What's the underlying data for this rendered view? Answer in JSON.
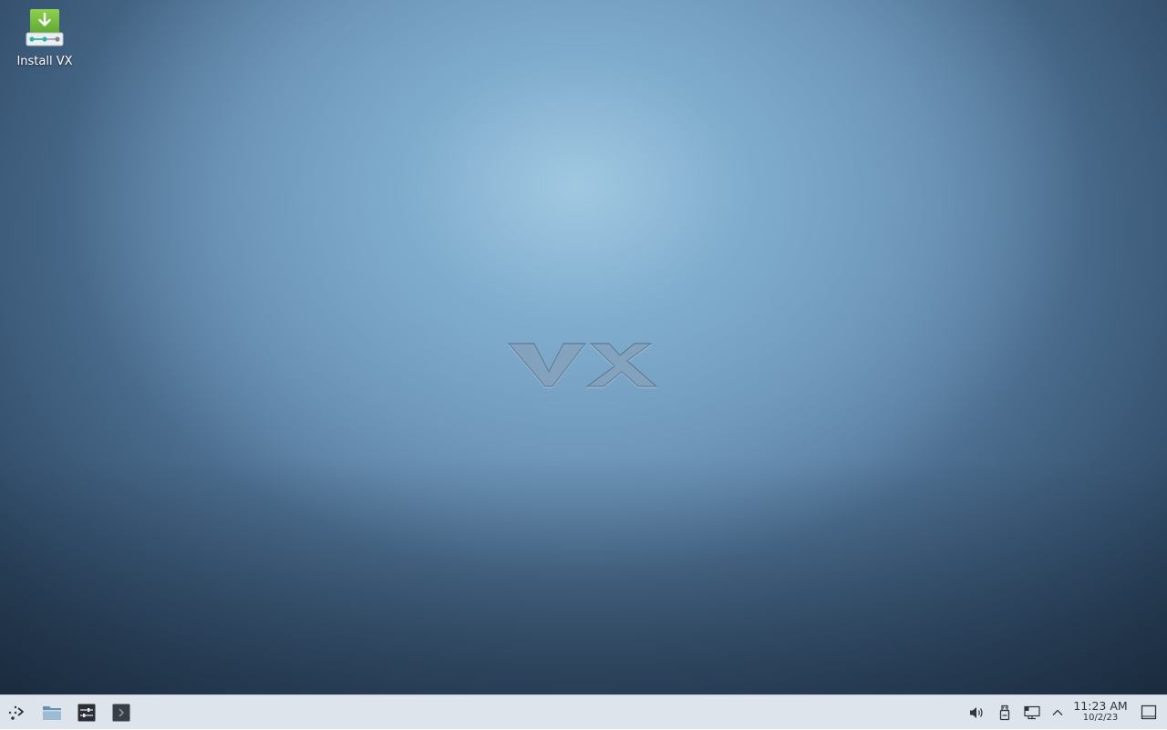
{
  "desktop": {
    "icons": [
      {
        "label": "Install VX",
        "icon": "install-download-icon"
      }
    ],
    "wallpaper_logo": "VX"
  },
  "taskbar": {
    "launcher_icon": "app-launcher-icon",
    "pinned": [
      {
        "icon": "file-manager-icon"
      },
      {
        "icon": "system-settings-icon"
      },
      {
        "icon": "terminal-icon"
      }
    ],
    "tray": [
      {
        "icon": "volume-icon"
      },
      {
        "icon": "usb-device-icon"
      },
      {
        "icon": "network-icon"
      },
      {
        "icon": "chevron-up-icon"
      }
    ],
    "clock": {
      "time": "11:23 AM",
      "date": "10/2/23"
    },
    "show_desktop_icon": "show-desktop-icon"
  },
  "colors": {
    "taskbar_bg": "#dde4ec",
    "install_icon_green": "#7cc142",
    "desktop_center": "#9cc4dd",
    "desktop_edge": "#1f3247"
  }
}
